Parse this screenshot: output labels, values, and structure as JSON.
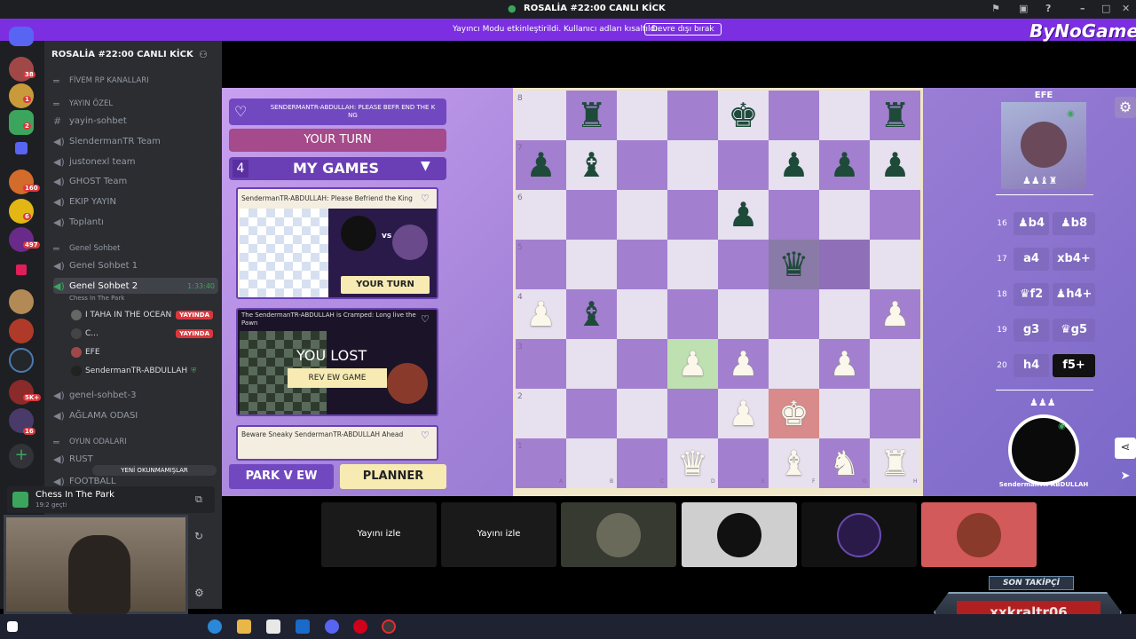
{
  "window": {
    "title": "ROSALİA #22:00 CANLI KİCK"
  },
  "banner": {
    "message": "Yayıncı Modu etkinleştirildi. Kullanıcı adları kısaltıldı.",
    "button": "Devre dışı bırak",
    "brand": "ByNoGame"
  },
  "guild_badges": [
    "38",
    "1",
    "2",
    "160",
    "6",
    "497",
    "5K+",
    "16"
  ],
  "sidebar": {
    "server_name": "ROSALİA #22:00 CANLI KİCK",
    "items": [
      {
        "label": "FİVEM RP KANALLARI",
        "type": "category"
      },
      {
        "label": "YAYIN ÖZEL",
        "type": "category"
      },
      {
        "label": "yayin-sohbet",
        "type": "text"
      },
      {
        "label": "SlendermanTR Team",
        "type": "voice"
      },
      {
        "label": "justonexl team",
        "type": "voice"
      },
      {
        "label": "GHOST Team",
        "type": "voice"
      },
      {
        "label": "EKIP YAYIN",
        "type": "voice"
      },
      {
        "label": "Toplantı",
        "type": "voice"
      },
      {
        "label": "Genel Sohbet",
        "type": "category"
      },
      {
        "label": "Genel Sohbet 1",
        "type": "voice"
      },
      {
        "label": "Genel Sohbet 2",
        "type": "voice",
        "time": "1:33:40",
        "activity": "Chess In The Park"
      },
      {
        "label": "genel-sohbet-3",
        "type": "voice"
      },
      {
        "label": "AĞLAMA ODASI",
        "type": "voice"
      },
      {
        "label": "OYUN ODALARI",
        "type": "category"
      },
      {
        "label": "RUST",
        "type": "voice"
      },
      {
        "label": "FOOTBALL",
        "type": "voice"
      }
    ],
    "voice_users": [
      {
        "name": "I TAHA IN THE OCEAN",
        "badge": "YAYINDA"
      },
      {
        "name": "C...",
        "badge": "YAYINDA"
      },
      {
        "name": "EFE",
        "badge": ""
      },
      {
        "name": "SendermanTR-ABDULLAH",
        "badge": ""
      }
    ],
    "unread_pill": "YENİ OKUNMAMIŞLAR",
    "now_playing": {
      "title": "Chess In The Park",
      "elapsed": "19:2 geçti"
    }
  },
  "game": {
    "header_msg": "SENDERMANTR-ABDULLAH: PLEASE BEFR END THE K NG",
    "your_turn": "YOUR TURN",
    "games_count": "4",
    "my_games": "MY GAMES",
    "card1_title": "SendermanTR-ABDULLAH: Please Befriend the King",
    "card1_vs": "vs",
    "card1_button": "YOUR TURN",
    "card2_title": "The SendermanTR-ABDULLAH is Cramped: Long live the Pawn",
    "card2_status": "YOU LOST",
    "card2_button": "REV EW GAME",
    "card3_title": "Beware Sneaky SendermanTR-ABDULLAH Ahead",
    "park_view": "PARK V EW",
    "planner": "PLANNER",
    "ranks": [
      "8",
      "7",
      "6",
      "5",
      "4",
      "3",
      "2",
      "1"
    ],
    "files": [
      "A",
      "B",
      "C",
      "D",
      "E",
      "F",
      "G",
      "H"
    ],
    "opponent_top": "EFE",
    "opponent_bottom": "SendermanTR-ABDULLAH",
    "moves": [
      {
        "n": "16",
        "w": "♟b4",
        "b": "♟b8"
      },
      {
        "n": "17",
        "w": "a4",
        "b": "xb4+"
      },
      {
        "n": "18",
        "w": "♛f2",
        "b": "♟h4+"
      },
      {
        "n": "19",
        "w": "g3",
        "b": "♛g5"
      },
      {
        "n": "20",
        "w": "h4",
        "b": "f5+"
      }
    ]
  },
  "stream_tiles": [
    {
      "label": "Yayını izle"
    },
    {
      "label": "Yayını izle"
    },
    {
      "label": ""
    },
    {
      "label": ""
    },
    {
      "label": ""
    },
    {
      "label": ""
    }
  ],
  "follower": {
    "title": "SON TAKİPÇİ",
    "name": "xxkraltr06"
  },
  "colors": {
    "banner": "#7b2fe0",
    "board_dark": "#a37fd0",
    "board_light": "#e6e0ef",
    "accent_button": "#f7ebb3"
  }
}
